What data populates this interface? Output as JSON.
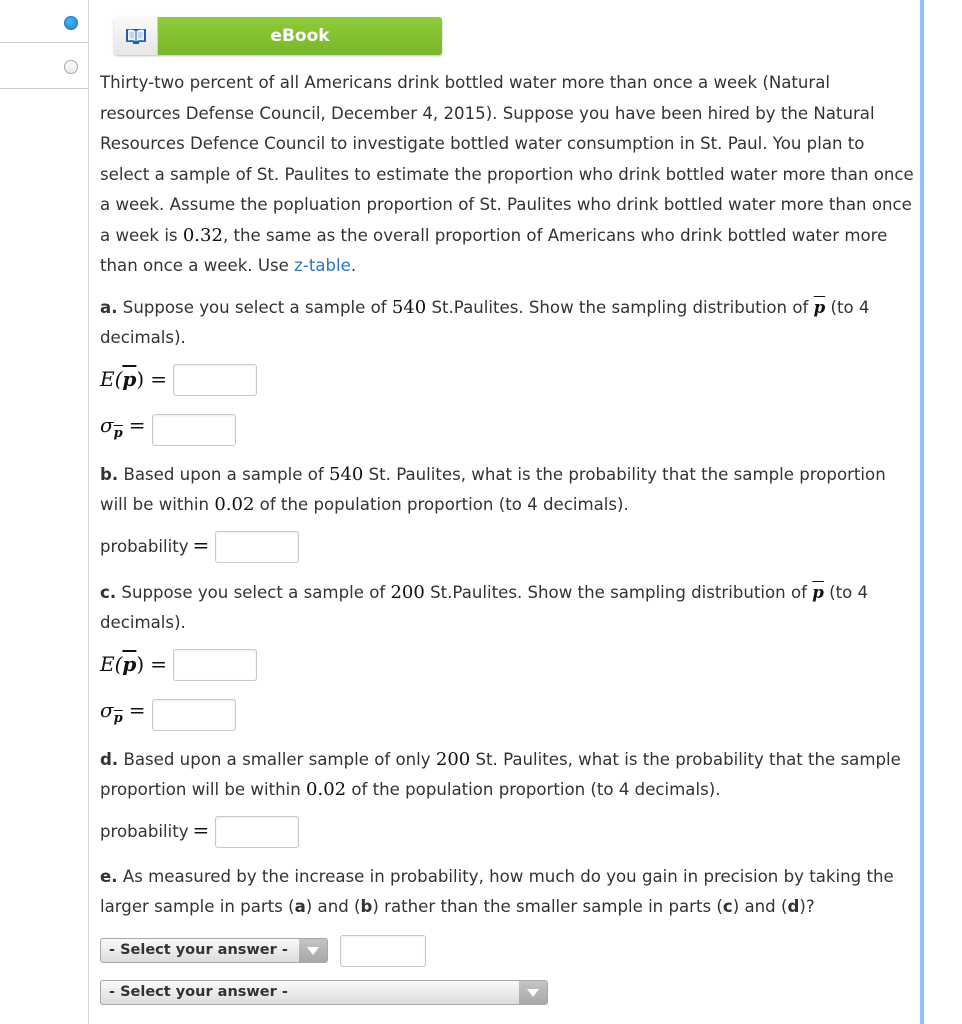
{
  "nav": {
    "items": [
      {
        "state": "selected"
      },
      {
        "state": "unselected"
      }
    ]
  },
  "ebook": {
    "label": "eBook",
    "icon": "open-book-icon"
  },
  "intro": {
    "text1": "Thirty-two percent of all Americans drink bottled water more than once a week (Natural resources Defense Council, December 4, 2015). Suppose you have been hired by the Natural Resources Defence Council to investigate bottled water consumption in St. Paul. You plan to select a sample of St. Paulites to estimate the proportion who drink bottled water more than once a week. Assume the popluation proportion of St. Paulites who drink bottled water more than once a week is ",
    "proportion": "0.32",
    "text2": ", the same as the overall proportion of Americans who drink bottled water more than once a week. Use ",
    "link": "z-table",
    "text3": "."
  },
  "part_a": {
    "letter": "a.",
    "text1": " Suppose you select a sample of ",
    "n": "540",
    "text2": " St.Paulites. Show the sampling distribution of ",
    "pbar": "p",
    "text3": " (to 4 decimals).",
    "e_label": "E(",
    "e_close": ")",
    "eq": "=",
    "sigma": "σ",
    "e_value": "",
    "sigma_value": ""
  },
  "part_b": {
    "letter": "b.",
    "text1": " Based upon a sample of ",
    "n": "540",
    "text2": " St. Paulites, what is the probability that the sample proportion will be within ",
    "within": "0.02",
    "text3": " of the population proportion (to 4 decimals).",
    "prob_label": "probability",
    "eq": "=",
    "value": ""
  },
  "part_c": {
    "letter": "c.",
    "text1": " Suppose you select a sample of ",
    "n": "200",
    "text2": " St.Paulites. Show the sampling distribution of ",
    "pbar": "p",
    "text3": " (to 4 decimals).",
    "e_label": "E(",
    "e_close": ")",
    "eq": "=",
    "sigma": "σ",
    "e_value": "",
    "sigma_value": ""
  },
  "part_d": {
    "letter": "d.",
    "text1": " Based upon a smaller sample of only ",
    "n": "200",
    "text2": " St. Paulites, what is the probability that the sample proportion will be within ",
    "within": "0.02",
    "text3": " of the population proportion (to 4 decimals).",
    "prob_label": "probability",
    "eq": "=",
    "value": ""
  },
  "part_e": {
    "letter": "e.",
    "text1": " As measured by the increase in probability, how much do you gain in precision by taking the larger sample in parts (",
    "ra": "a",
    "t2": ") and (",
    "rb": "b",
    "t3": ") rather than the smaller sample in parts (",
    "rc": "c",
    "t4": ") and (",
    "rd": "d",
    "t5": ")?",
    "select1": "- Select your answer -",
    "value": "",
    "select2": "- Select your answer -"
  }
}
